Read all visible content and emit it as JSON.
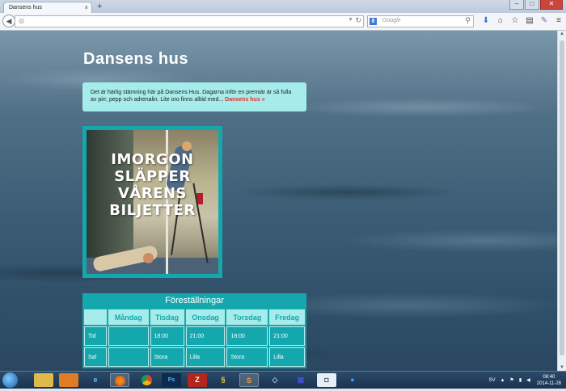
{
  "browser": {
    "tab_title": "Dansens hus",
    "tab_close": "×",
    "new_tab": "+",
    "search_engine_badge": "8",
    "search_placeholder": "Google",
    "window_buttons": [
      "–",
      "□",
      "✕"
    ]
  },
  "page": {
    "title": "Dansens hus",
    "intro_text": "Det är härlig stämning här på Dansens Hus. Dagarna inför en premiär är så fulla av pirr, pepp och adrenalin. Lite oro finns alltid med... ",
    "intro_link": "Dansens hus »",
    "promo_caption": "IMORGON SLÄPPER VÅRENS BILJETTER",
    "schedule": {
      "title": "Föreställningar",
      "columns": [
        "",
        "Måndag",
        "Tisdag",
        "Onsdag",
        "Torsdag",
        "Fredag"
      ],
      "rows": [
        [
          "Tid",
          "",
          "18:00",
          "21:00",
          "18:00",
          "21:00"
        ],
        [
          "Sal",
          "",
          "Stora",
          "Lilla",
          "Stora",
          "Lilla"
        ]
      ]
    }
  },
  "taskbar": {
    "icons": [
      "explorer-icon",
      "media-player-icon",
      "ie-icon",
      "firefox-icon",
      "chrome-icon",
      "photoshop-icon",
      "filezilla-icon",
      "python-icon",
      "sublime-icon",
      "virtualbox-icon",
      "grid-app-icon",
      "app-icon",
      "globe-app-icon"
    ],
    "language": "SV",
    "time": "08:40",
    "date": "2014-11-28"
  }
}
